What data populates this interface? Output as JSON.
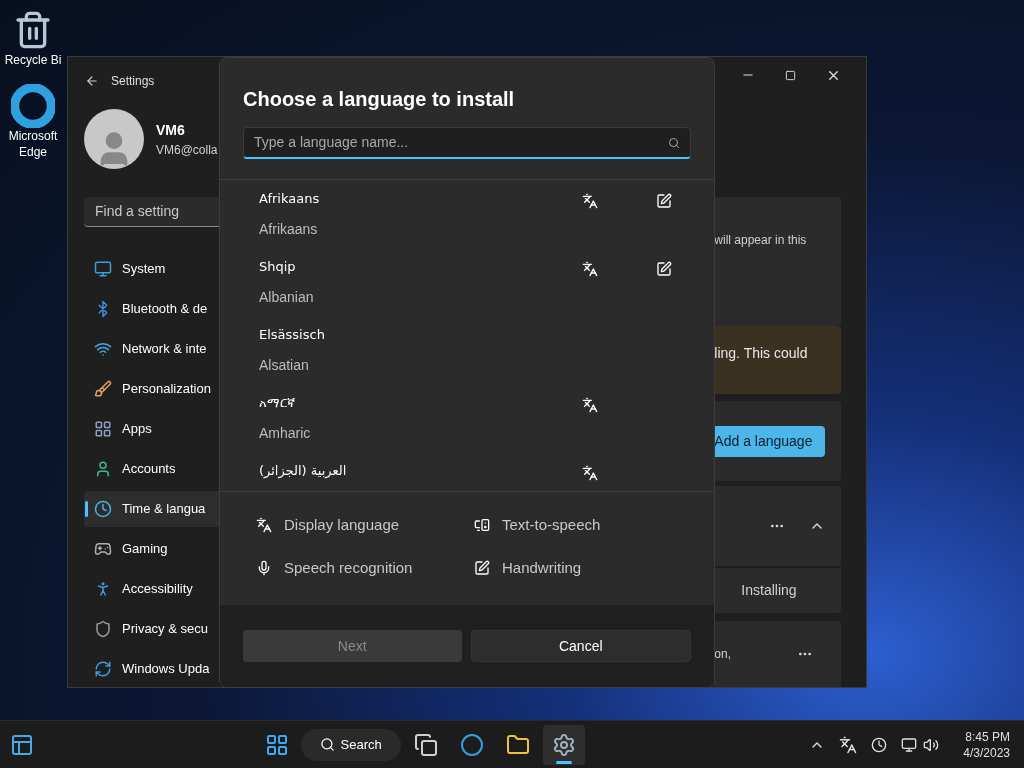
{
  "desktop": {
    "icons": [
      {
        "kind": "recycle",
        "label": "Recycle Bi"
      },
      {
        "kind": "edge",
        "label": "Microsoft Edge"
      }
    ]
  },
  "settings": {
    "title": "Settings",
    "profile": {
      "name": "VM6",
      "email": "VM6@colla"
    },
    "search": {
      "placeholder": "Find a setting"
    },
    "nav": [
      {
        "kind": "system",
        "label": "System",
        "selected": false
      },
      {
        "kind": "bluetooth",
        "label": "Bluetooth & de",
        "selected": false
      },
      {
        "kind": "network",
        "label": "Network & inte",
        "selected": false
      },
      {
        "kind": "personalization",
        "label": "Personalization",
        "selected": false
      },
      {
        "kind": "apps",
        "label": "Apps",
        "selected": false
      },
      {
        "kind": "accounts",
        "label": "Accounts",
        "selected": false
      },
      {
        "kind": "time",
        "label": "Time & langua",
        "selected": true
      },
      {
        "kind": "gaming",
        "label": "Gaming",
        "selected": false
      },
      {
        "kind": "accessibility",
        "label": "Accessibility",
        "selected": false
      },
      {
        "kind": "privacy",
        "label": "Privacy & secu",
        "selected": false
      },
      {
        "kind": "update",
        "label": "Windows Upda",
        "selected": false
      }
    ],
    "content": {
      "info_text": "will appear in this",
      "warning_text": "ling. This could",
      "add_button": "Add a language",
      "status": "Installing",
      "last_text": "on,"
    }
  },
  "dialog": {
    "title": "Choose a language to install",
    "search": {
      "placeholder": "Type a language name..."
    },
    "languages": [
      {
        "native": "Afrikaans",
        "english": "Afrikaans",
        "display": true,
        "handwriting": true
      },
      {
        "native": "Shqip",
        "english": "Albanian",
        "display": true,
        "handwriting": true
      },
      {
        "native": "Elsässisch",
        "english": "Alsatian",
        "display": false,
        "handwriting": false
      },
      {
        "native": "አማርኛ",
        "english": "Amharic",
        "display": true,
        "handwriting": false
      },
      {
        "native": "العربية (الجزائر)",
        "display": true,
        "handwriting": false
      }
    ],
    "legend": [
      {
        "kind": "display",
        "label": "Display language"
      },
      {
        "kind": "tts",
        "label": "Text-to-speech"
      },
      {
        "kind": "speech",
        "label": "Speech recognition"
      },
      {
        "kind": "handwriting",
        "label": "Handwriting"
      }
    ],
    "buttons": [
      {
        "label": "Next",
        "disabled": true
      },
      {
        "label": "Cancel",
        "disabled": false
      }
    ]
  },
  "taskbar": {
    "search": "Search",
    "apps": [
      {
        "kind": "taskview",
        "active": false
      },
      {
        "kind": "edge",
        "active": false
      },
      {
        "kind": "explorer",
        "active": false
      },
      {
        "kind": "settings",
        "active": true
      }
    ],
    "time": "8:45 PM",
    "date": "4/3/2023"
  }
}
